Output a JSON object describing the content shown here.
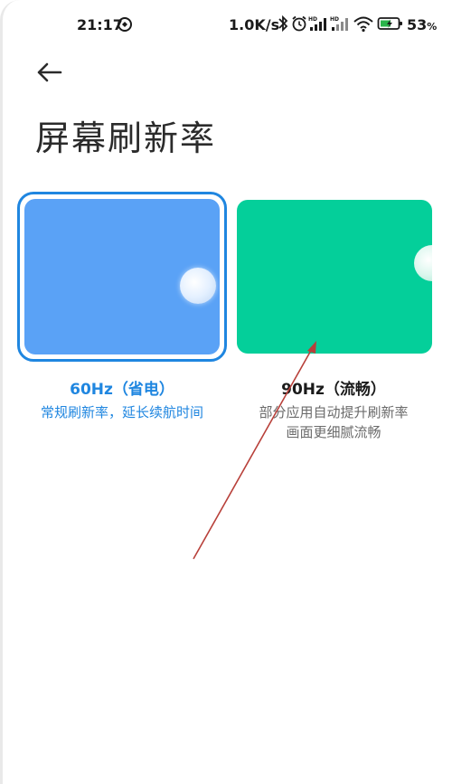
{
  "status_bar": {
    "time": "21:17",
    "net_speed": "1.0K/s",
    "battery_percent": "53",
    "battery_unit": "%",
    "icons": [
      "app-notification-icon",
      "bluetooth-icon",
      "alarm-icon",
      "hd-signal-icon",
      "hd-signal-icon",
      "wifi-icon",
      "battery-charging-icon"
    ]
  },
  "header": {
    "back_icon": "back-arrow-icon",
    "title": "屏幕刷新率"
  },
  "options": [
    {
      "name": "60Hz（省电）",
      "description_lines": [
        "常规刷新率，延长续航时间"
      ],
      "selected": true,
      "accent_color": "#1f86e0",
      "preview_color": "#5aa2f6"
    },
    {
      "name": "90Hz（流畅）",
      "description_lines": [
        "部分应用自动提升刷新率",
        "画面更细腻流畅"
      ],
      "selected": false,
      "preview_color": "#04cf9a"
    }
  ],
  "annotation": {
    "type": "arrow",
    "color": "#b8403a",
    "points_to": "90Hz option card"
  }
}
